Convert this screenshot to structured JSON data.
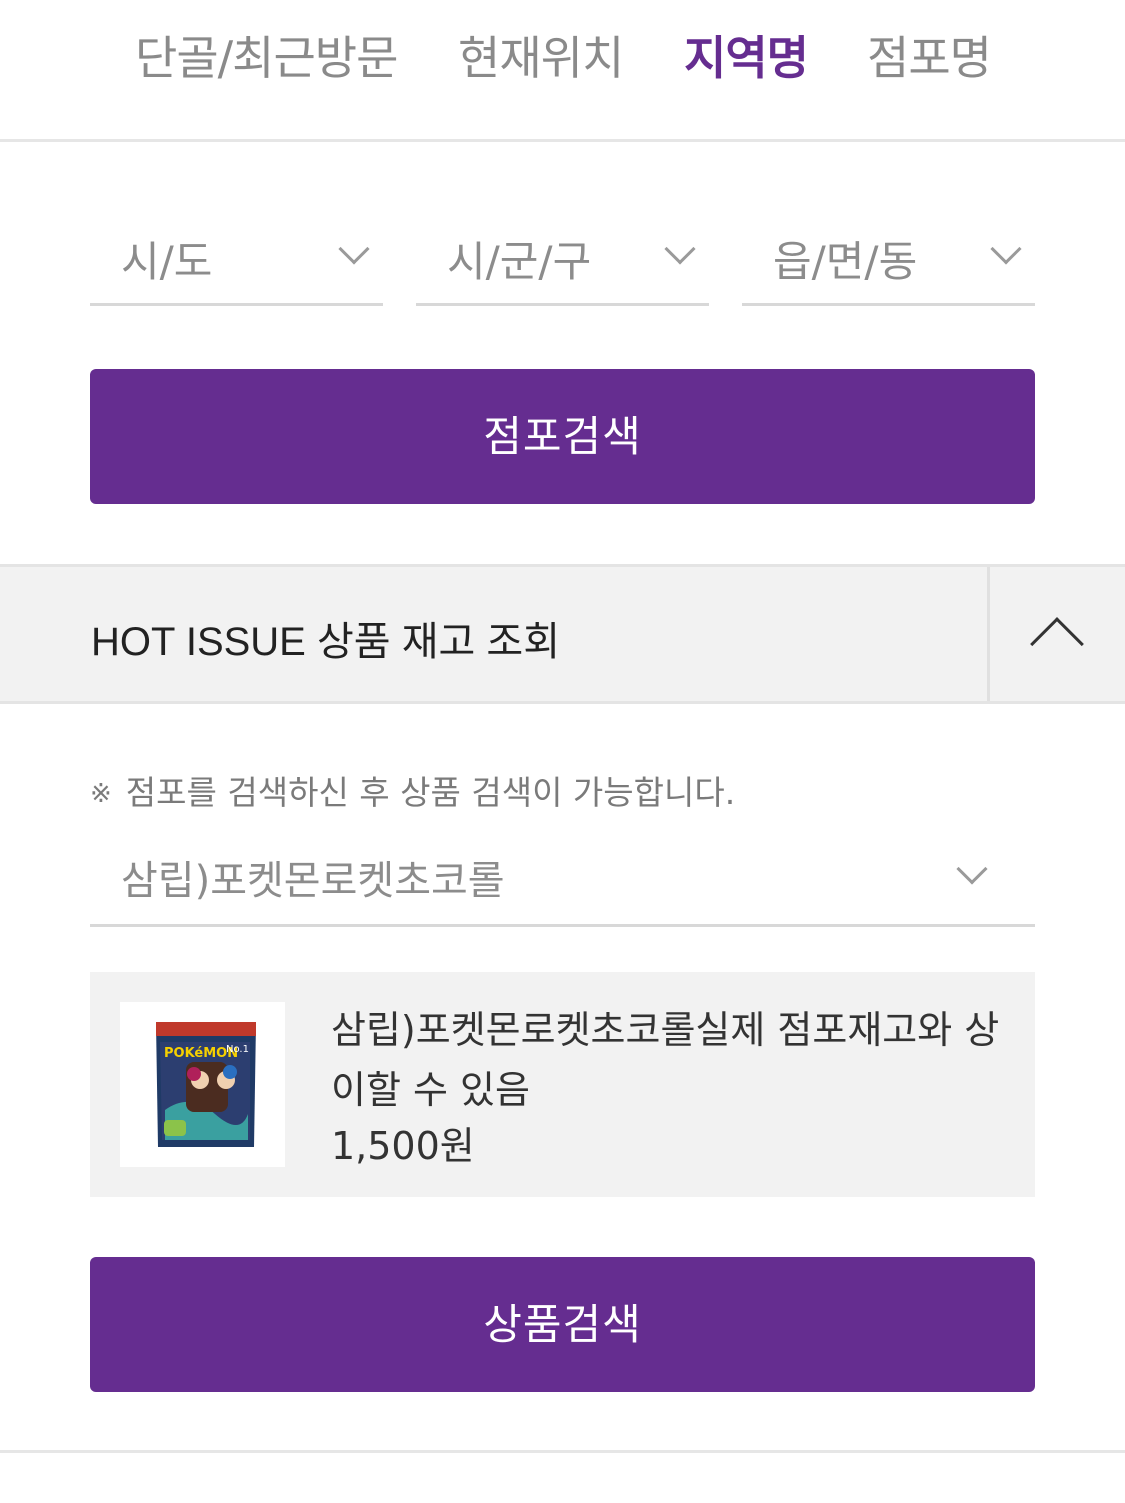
{
  "tabs": [
    {
      "label": "단골/최근방문",
      "active": false
    },
    {
      "label": "현재위치",
      "active": false
    },
    {
      "label": "지역명",
      "active": true
    },
    {
      "label": "점포명",
      "active": false
    }
  ],
  "region_selects": {
    "sido": "시/도",
    "sigungu": "시/군/구",
    "eupmyeondong": "읍/면/동"
  },
  "store_search_button": "점포검색",
  "hot_issue": {
    "title": "HOT ISSUE 상품 재고 조회",
    "note_mark": "※",
    "note": "점포를 검색하신 후 상품 검색이 가능합니다.",
    "product_select_value": "삼립)포켓몬로켓초코롤",
    "product": {
      "name": "삼립)포켓몬로켓초코롤실제 점포재고와 상이할 수 있음",
      "price": "1,500원",
      "image_text": {
        "brand": "POKéMON",
        "badge": "No.1"
      }
    },
    "search_button": "상품검색"
  },
  "colors": {
    "accent": "#652d90",
    "panel": "#f2f2f2"
  },
  "icons": {
    "select_arrow": "chevron-down-icon",
    "collapse": "chevron-up-icon"
  }
}
